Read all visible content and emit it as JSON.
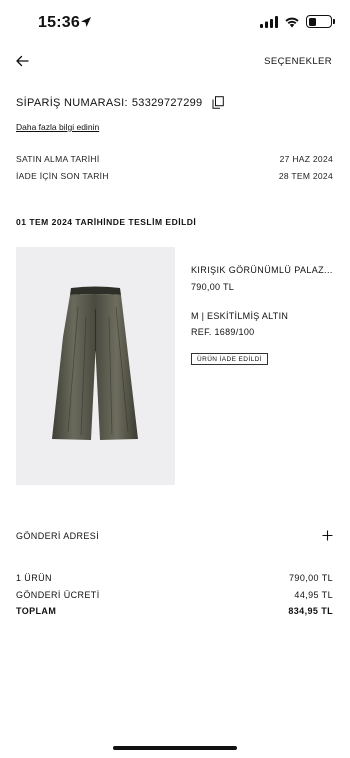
{
  "status_bar": {
    "time": "15:36",
    "icons": [
      "location-arrow-icon",
      "signal-icon",
      "wifi-icon",
      "battery-icon"
    ],
    "battery_level": 0.35
  },
  "header": {
    "back_icon": "arrow-left-icon",
    "options_label": "SEÇENEKLER"
  },
  "order": {
    "label": "SİPARİŞ NUMARASI:",
    "number": "53329727299",
    "copy_icon": "copy-icon",
    "info_link": "Daha fazla bilgi edinin",
    "dates": [
      {
        "label": "SATIN ALMA TARİHİ",
        "value": "27 HAZ 2024"
      },
      {
        "label": "İADE İÇİN SON TARİH",
        "value": "28 TEM 2024"
      }
    ]
  },
  "delivery": {
    "title": "01 TEM 2024 TARİHİNDE TESLİM EDİLDİ",
    "product": {
      "name": "KIRIŞIK GÖRÜNÜMLÜ PALAZ...",
      "price": "790,00 TL",
      "variant": "M | ESKİTİLMİŞ ALTIN",
      "ref": "REF. 1689/100",
      "status_badge": "ÜRÜN İADE EDİLDİ"
    }
  },
  "address": {
    "label": "GÖNDERİ ADRESİ",
    "expand_icon": "plus-icon"
  },
  "summary": {
    "items_label": "1 ÜRÜN",
    "items_value": "790,00 TL",
    "shipping_label": "GÖNDERİ ÜCRETİ",
    "shipping_value": "44,95 TL",
    "total_label": "TOPLAM",
    "total_value": "834,95 TL"
  },
  "colors": {
    "text": "#111111",
    "image_bg": "#eeeef0",
    "pants": "#4a4a40"
  }
}
